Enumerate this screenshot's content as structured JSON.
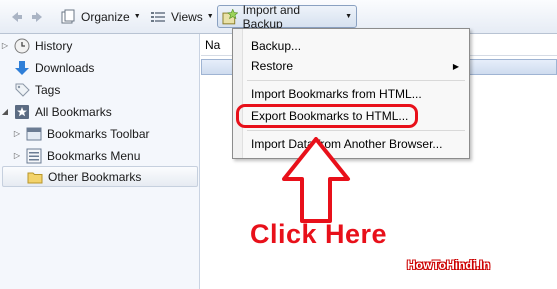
{
  "toolbar": {
    "organize_label": "Organize",
    "views_label": "Views",
    "import_backup_label": "Import and Backup"
  },
  "sidebar": {
    "items": [
      {
        "label": "History",
        "icon": "clock-icon"
      },
      {
        "label": "Downloads",
        "icon": "download-icon"
      },
      {
        "label": "Tags",
        "icon": "tag-icon"
      },
      {
        "label": "All Bookmarks",
        "icon": "star-icon"
      },
      {
        "label": "Bookmarks Toolbar",
        "icon": "toolbar-icon"
      },
      {
        "label": "Bookmarks Menu",
        "icon": "menu-icon"
      },
      {
        "label": "Other Bookmarks",
        "icon": "folder-icon"
      }
    ]
  },
  "content": {
    "column_header": "Na"
  },
  "menu": {
    "items": [
      {
        "label": "Backup..."
      },
      {
        "label": "Restore"
      },
      {
        "label": "Import Bookmarks from HTML..."
      },
      {
        "label": "Export Bookmarks to HTML..."
      },
      {
        "label": "Import Data from Another Browser..."
      }
    ]
  },
  "annotation": {
    "text": "Click Here",
    "watermark": "HowToHindi.In",
    "color": "#e8101a"
  }
}
